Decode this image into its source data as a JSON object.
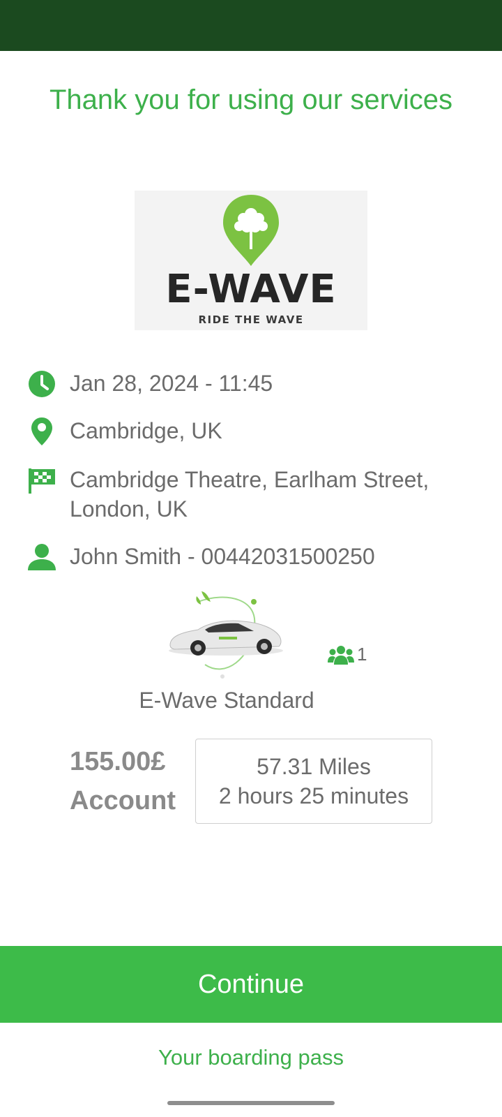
{
  "title": "Thank you for using our services",
  "logo": {
    "wordmark": "E-WAVE",
    "tagline": "RIDE THE WAVE",
    "icon": "tree-location-pin-icon"
  },
  "trip": {
    "date_time": "Jan 28, 2024 - 11:45",
    "pickup": "Cambridge, UK",
    "dropoff": "Cambridge Theatre, Earlham Street, London, UK",
    "passenger": "John Smith - 00442031500250"
  },
  "vehicle": {
    "name": "E-Wave Standard",
    "passenger_count": "1",
    "image_icon": "electric-car-image"
  },
  "fare": {
    "amount": "155.00£",
    "payment_method": "Account"
  },
  "summary": {
    "distance": "57.31 Miles",
    "duration": "2 hours 25 minutes"
  },
  "actions": {
    "continue_label": "Continue",
    "boarding_pass_label": "Your boarding pass"
  },
  "colors": {
    "accent": "#3db04b",
    "button": "#3dbb49",
    "status_bar": "#1b4a1f",
    "text": "#6b6b6b"
  }
}
